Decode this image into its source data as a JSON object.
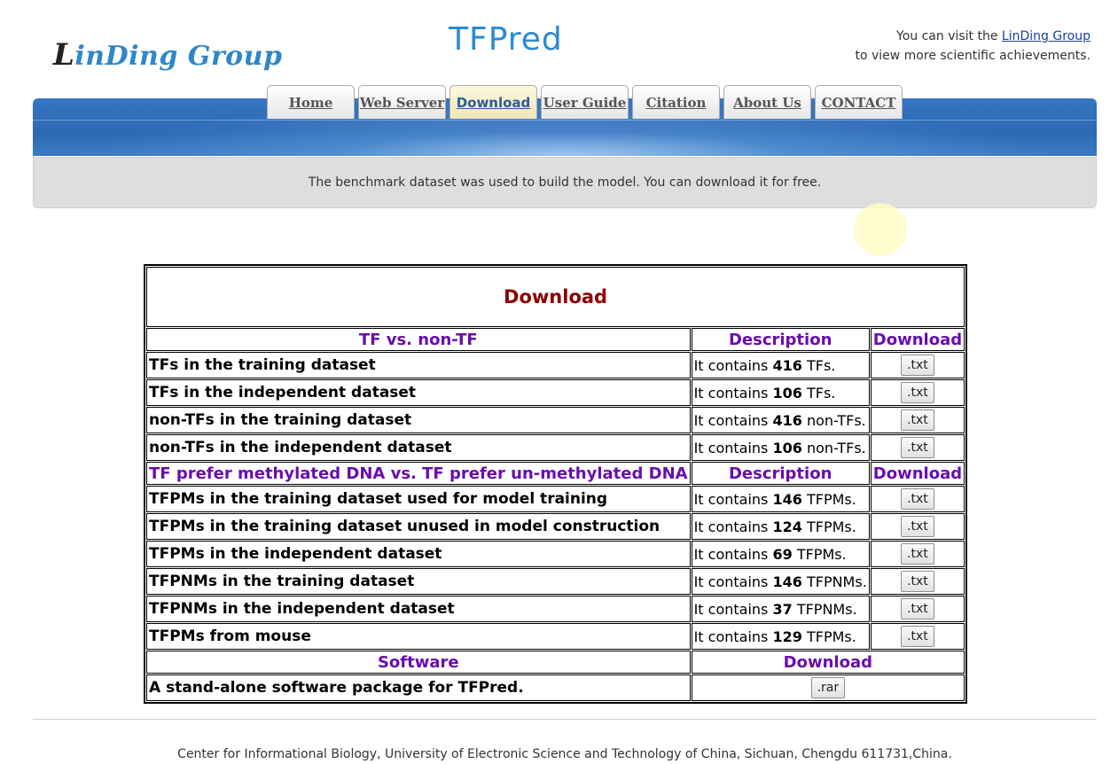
{
  "header": {
    "logo_initial": "L",
    "logo_rest": "inDing Group",
    "site_title": "TFPred",
    "visit_prefix": "You can visit the ",
    "visit_link": "LinDing Group",
    "visit_suffix": "to view more scientific achievements."
  },
  "nav": {
    "tabs": [
      {
        "label": "Home"
      },
      {
        "label": "Web Server"
      },
      {
        "label": "Download"
      },
      {
        "label": "User Guide"
      },
      {
        "label": "Citation"
      },
      {
        "label": "About Us"
      },
      {
        "label": "CONTACT"
      }
    ],
    "active": "Download"
  },
  "notice": "The benchmark dataset was used to build the model. You can download it for free.",
  "table": {
    "title": "Download",
    "section1": {
      "col1": "TF vs. non-TF",
      "col2": "Description",
      "col3": "Download"
    },
    "rows1": [
      {
        "name": "TFs in the training dataset",
        "pre": "It contains ",
        "num": "416",
        "post": " TFs.",
        "btn": ".txt"
      },
      {
        "name": "TFs in the independent dataset",
        "pre": "It contains ",
        "num": "106",
        "post": " TFs.",
        "btn": ".txt"
      },
      {
        "name": "non-TFs in the training dataset",
        "pre": "It contains ",
        "num": "416",
        "post": " non-TFs.",
        "btn": ".txt"
      },
      {
        "name": "non-TFs in the independent dataset",
        "pre": "It contains ",
        "num": "106",
        "post": " non-TFs.",
        "btn": ".txt"
      }
    ],
    "section2": {
      "col1": "TF prefer methylated DNA vs. TF prefer un-methylated DNA",
      "col2": "Description",
      "col3": "Download"
    },
    "rows2": [
      {
        "name": "TFPMs in the training dataset used for model training",
        "pre": "It contains ",
        "num": "146",
        "post": " TFPMs.",
        "btn": ".txt"
      },
      {
        "name": "TFPMs in the training dataset unused in model construction",
        "pre": "It contains ",
        "num": "124",
        "post": " TFPMs.",
        "btn": ".txt"
      },
      {
        "name": "TFPMs in the independent dataset",
        "pre": "It contains ",
        "num": "69",
        "post": " TFPMs.",
        "btn": ".txt"
      },
      {
        "name": "TFPNMs in the training dataset",
        "pre": "It contains ",
        "num": "146",
        "post": " TFPNMs.",
        "btn": ".txt"
      },
      {
        "name": "TFPNMs in the independent dataset",
        "pre": "It contains ",
        "num": "37",
        "post": " TFPNMs.",
        "btn": ".txt"
      },
      {
        "name": "TFPMs from mouse",
        "pre": "It contains ",
        "num": "129",
        "post": " TFPMs.",
        "btn": ".txt"
      }
    ],
    "section3": {
      "col1": "Software",
      "col2": "Download"
    },
    "software": {
      "name": "A stand-alone software package for TFPred.",
      "btn": ".rar"
    }
  },
  "footer": "Center for Informational Biology, University of Electronic Science and Technology of China, Sichuan, Chengdu 611731,China."
}
